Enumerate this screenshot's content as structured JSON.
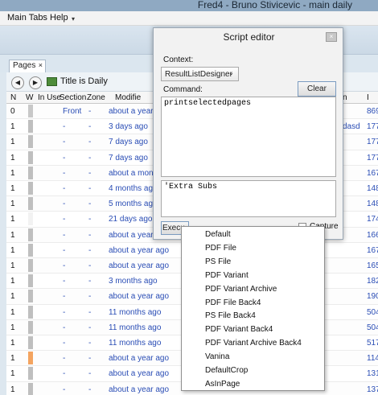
{
  "window": {
    "title": "Fred4 - Bruno Stivicevic - main daily"
  },
  "menu": {
    "items": [
      "Main Tabs",
      "Help"
    ],
    "caret": "▾"
  },
  "tabs": [
    {
      "label": "Pages",
      "close": "×"
    }
  ],
  "toolbar": {
    "back": "◀",
    "forward": "▶",
    "title": "Title is Daily"
  },
  "grid": {
    "columns": [
      "N",
      "W",
      "In Use",
      "Section",
      "Zone",
      "Modifie"
    ],
    "col_right_a": "n",
    "col_right_b": "I",
    "rows": [
      {
        "n": "0",
        "section": "Front",
        "zone": "-",
        "modified": "about a year a",
        "extra": "",
        "right": "869",
        "in_color": "#c8c8c8"
      },
      {
        "n": "1",
        "section": "-",
        "zone": "-",
        "modified": "3 days ago",
        "extra": "dasd",
        "right": "177",
        "in_color": "#bfbfbf"
      },
      {
        "n": "1",
        "section": "-",
        "zone": "-",
        "modified": "7 days ago",
        "extra": "",
        "right": "177",
        "in_color": "#bfbfbf"
      },
      {
        "n": "1",
        "section": "-",
        "zone": "-",
        "modified": "7 days ago",
        "extra": "",
        "right": "177",
        "in_color": "#bfbfbf"
      },
      {
        "n": "1",
        "section": "-",
        "zone": "-",
        "modified": "about a mont",
        "extra": "",
        "right": "167",
        "in_color": "#bfbfbf"
      },
      {
        "n": "1",
        "section": "-",
        "zone": "-",
        "modified": "4 months ago",
        "extra": "",
        "right": "148",
        "in_color": "#bfbfbf"
      },
      {
        "n": "1",
        "section": "-",
        "zone": "-",
        "modified": "5 months ago",
        "extra": "",
        "right": "148",
        "in_color": "#bfbfbf"
      },
      {
        "n": "1",
        "section": "-",
        "zone": "-",
        "modified": "21 days ago",
        "extra": "",
        "right": "174",
        "in_color": "#f2f2f2"
      },
      {
        "n": "1",
        "section": "-",
        "zone": "-",
        "modified": "about a year a",
        "extra": "",
        "right": "166",
        "in_color": "#bfbfbf"
      },
      {
        "n": "1",
        "section": "-",
        "zone": "-",
        "modified": "about a year ago",
        "extra": "",
        "right": "167",
        "in_color": "#bfbfbf"
      },
      {
        "n": "1",
        "section": "-",
        "zone": "-",
        "modified": "about a year ago",
        "extra": "",
        "right": "165",
        "in_color": "#bfbfbf"
      },
      {
        "n": "1",
        "section": "-",
        "zone": "-",
        "modified": "3 months ago",
        "extra": "",
        "right": "182",
        "in_color": "#bfbfbf"
      },
      {
        "n": "1",
        "section": "-",
        "zone": "-",
        "modified": "about a year ago",
        "extra": "",
        "right": "190",
        "in_color": "#bfbfbf"
      },
      {
        "n": "1",
        "section": "-",
        "zone": "-",
        "modified": "11 months ago",
        "extra": "",
        "right": "504",
        "in_color": "#bfbfbf"
      },
      {
        "n": "1",
        "section": "-",
        "zone": "-",
        "modified": "11 months ago",
        "extra": "",
        "right": "504",
        "in_color": "#bfbfbf"
      },
      {
        "n": "1",
        "section": "-",
        "zone": "-",
        "modified": "11 months ago",
        "extra": "",
        "right": "517",
        "in_color": "#bfbfbf"
      },
      {
        "n": "1",
        "section": "-",
        "zone": "-",
        "modified": "about a year ago",
        "extra": "",
        "right": "114",
        "in_color": "#f4a460"
      },
      {
        "n": "1",
        "section": "-",
        "zone": "-",
        "modified": "about a year ago",
        "extra": "",
        "right": "131",
        "in_color": "#bfbfbf"
      },
      {
        "n": "1",
        "section": "-",
        "zone": "-",
        "modified": "about a year ago",
        "extra": "",
        "right": "137",
        "in_color": "#bfbfbf"
      }
    ]
  },
  "script_editor": {
    "title": "Script editor",
    "close": "×",
    "context_label": "Context:",
    "context_value": "ResultListDesigner",
    "caret": "⌄",
    "command_label": "Command:",
    "clear_label": "Clear",
    "command_text": "printselectedpages",
    "output_text": "'Extra Subs",
    "execute_label": "Execu",
    "capture_label": "Capture"
  },
  "context_menu": {
    "items": [
      "Default",
      "PDF File",
      "PS File",
      "PDF Variant",
      "PDF Variant Archive",
      "PDF File Back4",
      "PS File Back4",
      "PDF Variant Back4",
      "PDF Variant Archive Back4",
      "Vanina",
      "DefaultCrop",
      "AsInPage"
    ]
  }
}
